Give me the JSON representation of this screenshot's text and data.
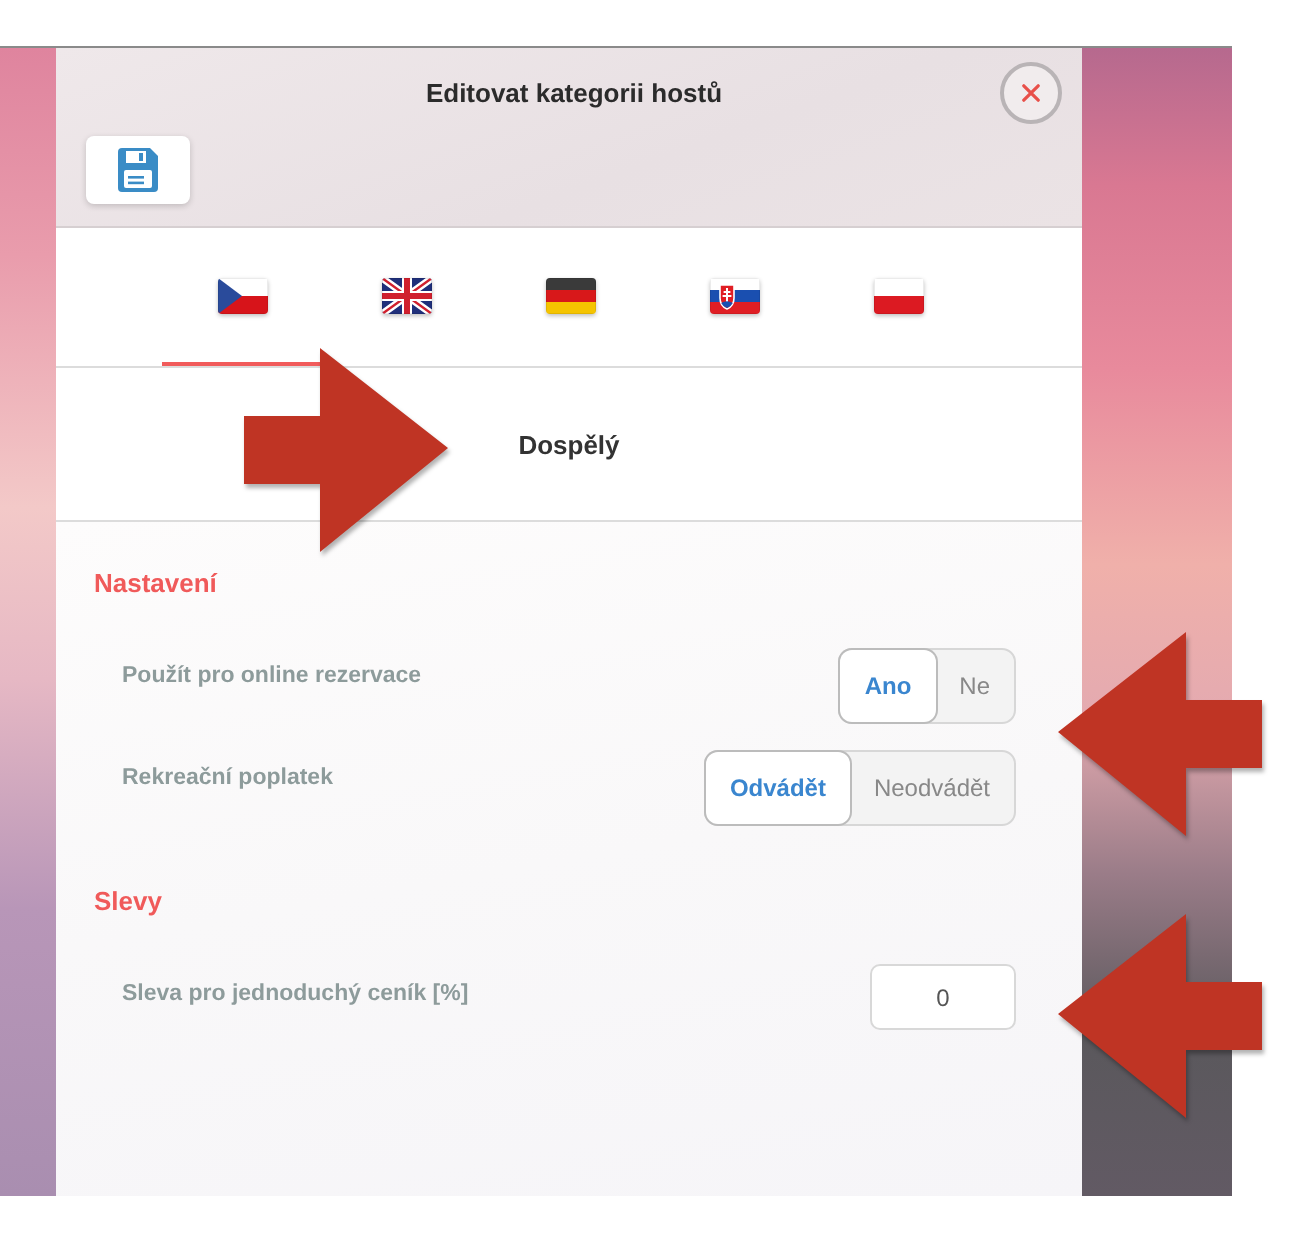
{
  "window": {
    "title": "Editovat kategorii hostů"
  },
  "language_tabs": [
    {
      "kind": "czech",
      "selected": true
    },
    {
      "kind": "british",
      "selected": false
    },
    {
      "kind": "german",
      "selected": false
    },
    {
      "kind": "slovak",
      "selected": false
    },
    {
      "kind": "polish",
      "selected": false
    }
  ],
  "category": {
    "name": "Dospělý"
  },
  "sections": [
    {
      "title": "Nastavení",
      "rows": [
        {
          "kind": "toggle",
          "label": "Použít pro online rezervace",
          "options": [
            {
              "label": "Ano",
              "selected": true
            },
            {
              "label": "Ne",
              "selected": false
            }
          ]
        },
        {
          "kind": "toggle",
          "label": "Rekreační poplatek",
          "options": [
            {
              "label": "Odvádět",
              "selected": true
            },
            {
              "label": "Neodvádět",
              "selected": false
            }
          ]
        }
      ]
    },
    {
      "title": "Slevy",
      "rows": [
        {
          "kind": "number",
          "label": "Sleva pro jednoduchý ceník [%]",
          "value": "0"
        }
      ]
    }
  ],
  "annotation_arrows": [
    {
      "kind": "right"
    },
    {
      "kind": "left"
    },
    {
      "kind": "left"
    }
  ]
}
